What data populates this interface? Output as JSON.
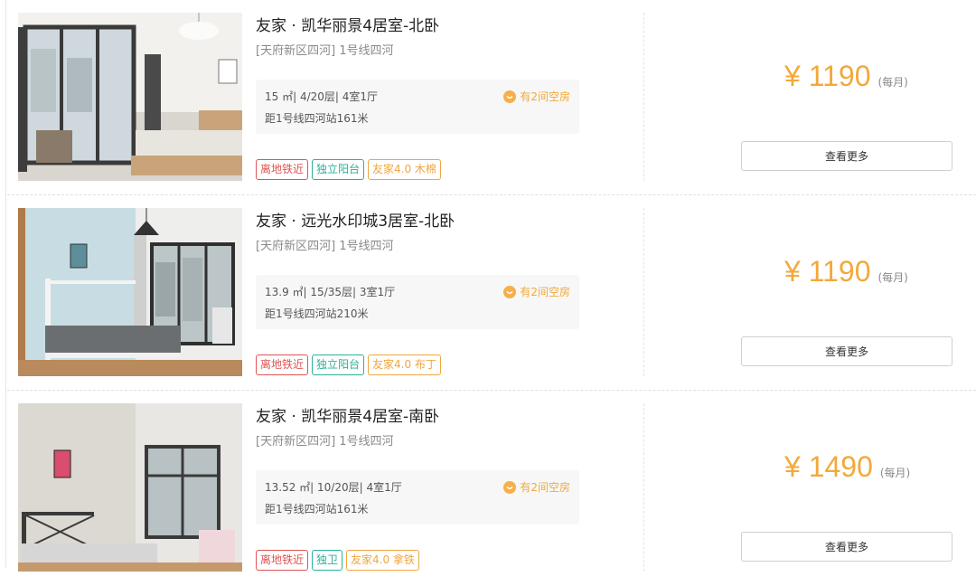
{
  "listings": [
    {
      "title": "友家 · 凯华丽景4居室-北卧",
      "location": "[天府新区四河] 1号线四河",
      "specs": "15 ㎡| 4/20层| 4室1厅",
      "distance": "距1号线四河站161米",
      "vacancy": "有2间空房",
      "tags": [
        "离地铁近",
        "独立阳台",
        "友家4.0 木棉"
      ],
      "price": "¥ 1190",
      "price_unit": "(每月)",
      "more_label": "查看更多"
    },
    {
      "title": "友家 · 远光水印城3居室-北卧",
      "location": "[天府新区四河] 1号线四河",
      "specs": "13.9 ㎡| 15/35层| 3室1厅",
      "distance": "距1号线四河站210米",
      "vacancy": "有2间空房",
      "tags": [
        "离地铁近",
        "独立阳台",
        "友家4.0 布丁"
      ],
      "price": "¥ 1190",
      "price_unit": "(每月)",
      "more_label": "查看更多"
    },
    {
      "title": "友家 · 凯华丽景4居室-南卧",
      "location": "[天府新区四河] 1号线四河",
      "specs": "13.52 ㎡| 10/20层| 4室1厅",
      "distance": "距1号线四河站161米",
      "vacancy": "有2间空房",
      "tags": [
        "离地铁近",
        "独卫",
        "友家4.0 拿铁"
      ],
      "price": "¥ 1490",
      "price_unit": "(每月)",
      "more_label": "查看更多"
    }
  ],
  "colors": {
    "price": "#f2a93b",
    "tag_red": "#e05454",
    "tag_teal": "#2bb19a",
    "tag_orange": "#f0a640"
  },
  "icons": {
    "vacancy": "smile-icon"
  }
}
